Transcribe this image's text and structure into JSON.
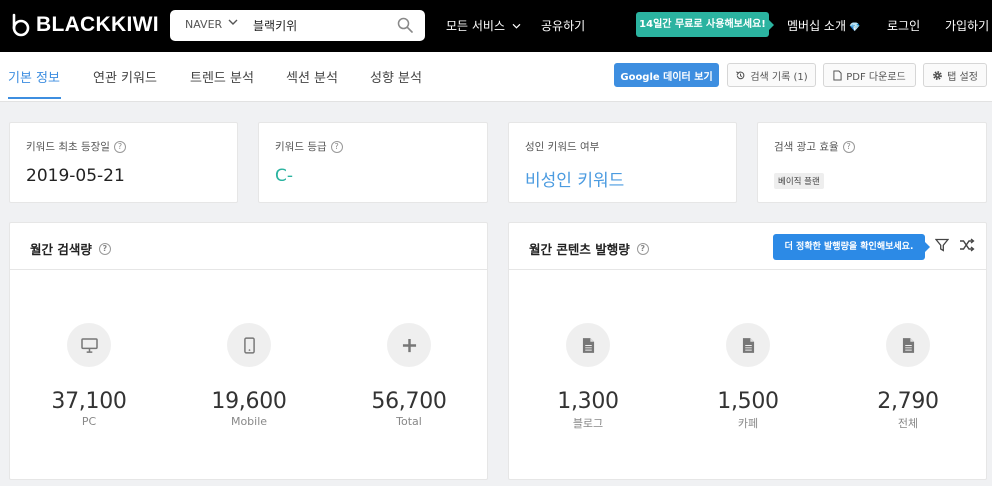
{
  "header": {
    "logo": "BLACKKIWI",
    "search": {
      "engine": "NAVER",
      "query": "블랙키위"
    },
    "nav": {
      "services": "모든 서비스",
      "share": "공유하기",
      "promo": "14일간 무료로 사용해보세요!",
      "membership": "멤버십 소개",
      "login": "로그인",
      "signup": "가입하기"
    }
  },
  "tabs": [
    "기본 정보",
    "연관 키워드",
    "트렌드 분석",
    "섹션 분석",
    "성향 분석"
  ],
  "actions": {
    "google": "Google 데이터 보기",
    "history": "검색 기록 (1)",
    "pdf": "PDF 다운로드",
    "tab_settings": "탭 설정"
  },
  "info_cards": [
    {
      "label": "키워드 최초 등장일",
      "value": "2019-05-21"
    },
    {
      "label": "키워드 등급",
      "value": "C-"
    },
    {
      "label": "성인 키워드 여부",
      "value": "비성인 키워드"
    },
    {
      "label": "검색 광고 효율",
      "value": "베이직 플랜"
    }
  ],
  "monthly_search": {
    "title": "월간 검색량",
    "stats": [
      {
        "value": "37,100",
        "label": "PC",
        "icon": "monitor-icon"
      },
      {
        "value": "19,600",
        "label": "Mobile",
        "icon": "mobile-icon"
      },
      {
        "value": "56,700",
        "label": "Total",
        "icon": "plus-icon"
      }
    ]
  },
  "monthly_content": {
    "title": "월간 콘텐츠 발행량",
    "tooltip": "더 정확한 발행량을 확인해보세요.",
    "stats": [
      {
        "value": "1,300",
        "label": "블로그",
        "icon": "document-icon"
      },
      {
        "value": "1,500",
        "label": "카페",
        "icon": "document-icon"
      },
      {
        "value": "2,790",
        "label": "전체",
        "icon": "document-icon"
      }
    ]
  },
  "colors": {
    "accent": "#3d8ee0",
    "teal": "#2bb3a0",
    "header_bg": "#000000"
  }
}
